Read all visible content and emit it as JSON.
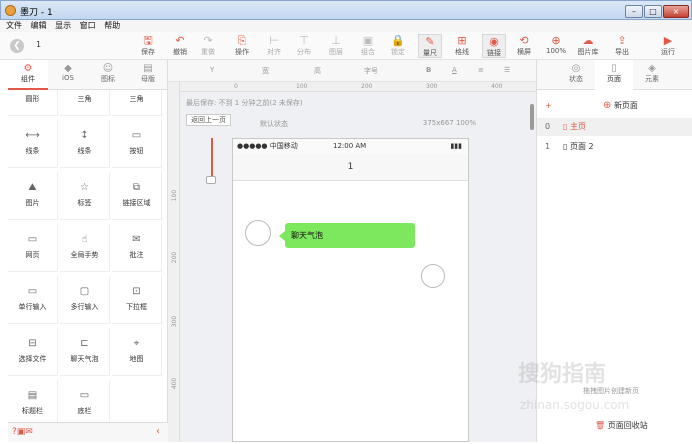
{
  "window": {
    "title": "墨刀 - 1",
    "min": "–",
    "max": "□",
    "close": "×"
  },
  "menu": [
    "文件",
    "编辑",
    "显示",
    "窗口",
    "帮助"
  ],
  "toolbar": {
    "page_num": "1",
    "buttons": [
      {
        "label": "保存",
        "icon": "save-icon",
        "glyph": "🖫",
        "state": "normal"
      },
      {
        "label": "撤销",
        "icon": "undo-icon",
        "glyph": "↶",
        "state": "normal"
      },
      {
        "label": "重做",
        "icon": "redo-icon",
        "glyph": "↷",
        "state": "disabled"
      },
      {
        "label": "操作",
        "icon": "link-icon",
        "glyph": "⎘",
        "state": "normal"
      },
      {
        "label": "对齐",
        "icon": "align-icon",
        "glyph": "⊢",
        "state": "disabled"
      },
      {
        "label": "分布",
        "icon": "distribute-icon",
        "glyph": "⊤",
        "state": "disabled"
      },
      {
        "label": "图层",
        "icon": "layers-icon",
        "glyph": "⊥",
        "state": "disabled"
      },
      {
        "label": "组合",
        "icon": "group-icon",
        "glyph": "▣",
        "state": "disabled"
      },
      {
        "label": "锁定",
        "icon": "lock-icon",
        "glyph": "🔒",
        "state": "disabled"
      },
      {
        "label": "量尺",
        "icon": "ruler-icon",
        "glyph": "✎",
        "state": "active"
      },
      {
        "label": "格线",
        "icon": "grid-icon",
        "glyph": "⊞",
        "state": "normal"
      },
      {
        "label": "链接",
        "icon": "eye-icon",
        "glyph": "◉",
        "state": "active"
      },
      {
        "label": "横屏",
        "icon": "rotate-icon",
        "glyph": "⟲",
        "state": "normal"
      },
      {
        "label": "100%",
        "icon": "zoom-icon",
        "glyph": "⊕",
        "state": "normal"
      },
      {
        "label": "图片库",
        "icon": "image-library-icon",
        "glyph": "☁",
        "state": "normal"
      },
      {
        "label": "导出",
        "icon": "export-icon",
        "glyph": "⇪",
        "state": "normal"
      },
      {
        "label": "运行",
        "icon": "run-icon",
        "glyph": "▶",
        "state": "normal"
      }
    ]
  },
  "left_tabs": [
    {
      "label": "组件",
      "icon": "components-icon",
      "glyph": "⚙"
    },
    {
      "label": "iOS",
      "icon": "apple-icon",
      "glyph": ""
    },
    {
      "label": "图标",
      "icon": "smiley-icon",
      "glyph": "☺"
    },
    {
      "label": "母版",
      "icon": "master-icon",
      "glyph": "▤"
    }
  ],
  "widgets": [
    {
      "label": "圆形",
      "icon": "circle-icon",
      "glyph": "○"
    },
    {
      "label": "三角",
      "icon": "triangle-icon",
      "glyph": "△"
    },
    {
      "label": "三角",
      "icon": "triangle-icon",
      "glyph": "▽"
    },
    {
      "label": "线条",
      "icon": "hline-icon",
      "glyph": "⟷"
    },
    {
      "label": "线条",
      "icon": "vline-icon",
      "glyph": "↕"
    },
    {
      "label": "按钮",
      "icon": "button-icon",
      "glyph": "▭"
    },
    {
      "label": "图片",
      "icon": "image-icon",
      "glyph": "⛰"
    },
    {
      "label": "标签",
      "icon": "tag-icon",
      "glyph": "☆"
    },
    {
      "label": "链接区域",
      "icon": "link-area-icon",
      "glyph": "⧉"
    },
    {
      "label": "网页",
      "icon": "webpage-icon",
      "glyph": "▭"
    },
    {
      "label": "全局手势",
      "icon": "gesture-icon",
      "glyph": "☝"
    },
    {
      "label": "批注",
      "icon": "comment-icon",
      "glyph": "✉"
    },
    {
      "label": "单行输入",
      "icon": "single-input-icon",
      "glyph": "▭"
    },
    {
      "label": "多行输入",
      "icon": "multi-input-icon",
      "glyph": "▢"
    },
    {
      "label": "下拉框",
      "icon": "dropdown-icon",
      "glyph": "⊡"
    },
    {
      "label": "选择文件",
      "icon": "file-select-icon",
      "glyph": "⊟"
    },
    {
      "label": "聊天气泡",
      "icon": "chat-bubble-icon",
      "glyph": "⊏"
    },
    {
      "label": "地图",
      "icon": "map-icon",
      "glyph": "⌖"
    },
    {
      "label": "标题栏",
      "icon": "titlebar-icon",
      "glyph": "▤"
    },
    {
      "label": "底栏",
      "icon": "bottombar-icon",
      "glyph": "▭"
    }
  ],
  "props": {
    "y": "Y",
    "w": "宽",
    "h": "高",
    "font": "字号",
    "bold": "B",
    "color": "A",
    "align": "≡",
    "more": "☰"
  },
  "ruler_h": [
    "0",
    "100",
    "200",
    "300",
    "400"
  ],
  "ruler_v": [
    "100",
    "200",
    "300",
    "400"
  ],
  "canvas": {
    "save_note": "最后保存: 不到 1 分钟之前(2 未保存)",
    "back_button": "返回上一页",
    "state_label": "默认状态",
    "size_label": "375x667 100%",
    "status_left": "●●●●● 中国移动",
    "status_time": "12:00 AM",
    "battery": "▮▮▮",
    "nav_title": "1",
    "bubble_text": "聊天气泡"
  },
  "right_tabs": [
    {
      "label": "状态",
      "icon": "state-icon",
      "glyph": "◎"
    },
    {
      "label": "页面",
      "icon": "page-icon",
      "glyph": "▯"
    },
    {
      "label": "元素",
      "icon": "element-icon",
      "glyph": "◈"
    }
  ],
  "pages": {
    "new_page": "新页面",
    "plus": "+",
    "items": [
      {
        "num": "0",
        "name": "▯ 主页"
      },
      {
        "num": "1",
        "name": "▯ 页面 2"
      }
    ],
    "drag_note": "拖拽图片创建新页",
    "recycle": "页面回收站"
  },
  "watermark": {
    "text": "搜狗指南",
    "url": "zhinan.sogou.com"
  },
  "colors": {
    "accent": "#e05a47",
    "bubble": "#7de75d"
  }
}
